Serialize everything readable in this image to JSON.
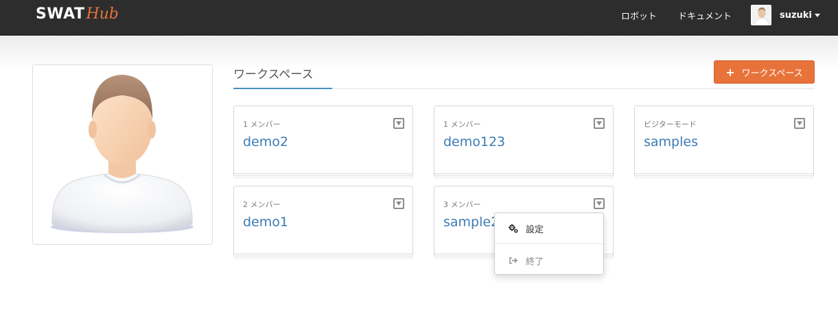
{
  "navbar": {
    "brand_main": "SWAT",
    "brand_sub": "Hub",
    "links": [
      "ロボット",
      "ドキュメント"
    ],
    "username": "suzuki"
  },
  "workspaces_section": {
    "title": "ワークスペース",
    "add_button_label": "ワークスペース",
    "cards": [
      {
        "meta": "1 メンバー",
        "name": "demo2"
      },
      {
        "meta": "1 メンバー",
        "name": "demo123"
      },
      {
        "meta": "ビジターモード",
        "name": "samples"
      },
      {
        "meta": "2 メンバー",
        "name": "demo1"
      },
      {
        "meta": "3 メンバー",
        "name": "sample2"
      }
    ]
  },
  "dropdown": {
    "items": [
      {
        "label": "設定",
        "icon": "gears-icon"
      },
      {
        "label": "終了",
        "icon": "sign-out-icon"
      }
    ]
  },
  "colors": {
    "navbar_bg": "#2d2d2d",
    "brand_accent": "#e8733a",
    "link_blue": "#3b7bb4",
    "button_orange": "#e8733a"
  }
}
